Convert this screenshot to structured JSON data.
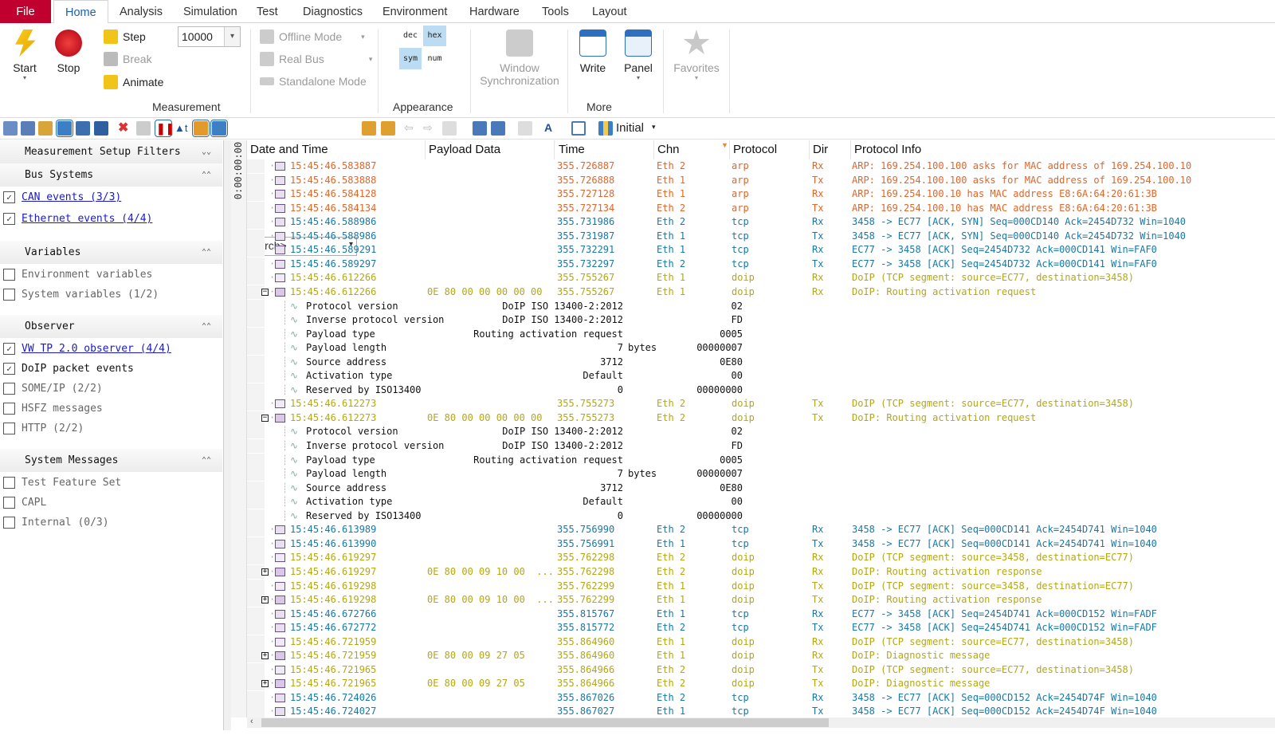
{
  "tabs": [
    "File",
    "Home",
    "Analysis",
    "Simulation",
    "Test",
    "Diagnostics",
    "Environment",
    "Hardware",
    "Tools",
    "Layout"
  ],
  "ribbon": {
    "start": "Start",
    "stop": "Stop",
    "step": "Step",
    "break": "Break",
    "animate": "Animate",
    "step_count": "10000",
    "offline_mode": "Offline Mode",
    "real_bus": "Real Bus",
    "standalone_mode": "Standalone Mode",
    "dec": "dec",
    "hex": "hex",
    "sym": "sym",
    "num": "num",
    "window_sync_1": "Window",
    "window_sync_2": "Synchronization",
    "write": "Write",
    "panel": "Panel",
    "favorites": "Favorites",
    "groups": {
      "measurement": "Measurement",
      "appearance": "Appearance",
      "more": "More"
    }
  },
  "toolbar": {
    "search_placeholder": "<Search>",
    "layout": "Initial"
  },
  "sidebar": {
    "title": "Measurement Setup Filters",
    "sections": [
      {
        "title": "Bus Systems",
        "items": [
          {
            "label": "CAN events (3/3)",
            "checked": true,
            "link": true
          },
          {
            "label": "Ethernet events (4/4)",
            "checked": true,
            "link": true
          }
        ]
      },
      {
        "title": "Variables",
        "items": [
          {
            "label": "Environment variables",
            "checked": false
          },
          {
            "label": "System variables (1/2)",
            "checked": false
          }
        ]
      },
      {
        "title": "Observer",
        "items": [
          {
            "label": "VW TP 2.0 observer (4/4)",
            "checked": true,
            "link": true
          },
          {
            "label": "DoIP packet events",
            "checked": true
          },
          {
            "label": "SOME/IP (2/2)",
            "checked": false
          },
          {
            "label": "HSFZ messages",
            "checked": false
          },
          {
            "label": "HTTP (2/2)",
            "checked": false
          }
        ]
      },
      {
        "title": "System Messages",
        "items": [
          {
            "label": "Test Feature Set",
            "checked": false
          },
          {
            "label": "CAPL",
            "checked": false
          },
          {
            "label": "Internal (0/3)",
            "checked": false
          }
        ]
      }
    ]
  },
  "time_offset": "0:00:00:00",
  "colors": {
    "arp": "#e0662a",
    "tcp": "#1a78a6",
    "doip": "#b3a814",
    "detail": "#111111"
  },
  "columns": [
    "Date and Time",
    "Payload Data",
    "Time",
    "Chn",
    "Protocol",
    "Dir",
    "Protocol Info"
  ],
  "rows": [
    {
      "k": "arp",
      "t": "15:45:46.583887",
      "p": "",
      "tm": "355.726887",
      "c": "Eth 2",
      "pr": "arp",
      "d": "Rx",
      "i": "ARP: 169.254.100.100 asks for MAC address of 169.254.100.10"
    },
    {
      "k": "arp",
      "t": "15:45:46.583888",
      "p": "",
      "tm": "355.726888",
      "c": "Eth 1",
      "pr": "arp",
      "d": "Tx",
      "i": "ARP: 169.254.100.100 asks for MAC address of 169.254.100.10"
    },
    {
      "k": "arp",
      "t": "15:45:46.584128",
      "p": "",
      "tm": "355.727128",
      "c": "Eth 1",
      "pr": "arp",
      "d": "Rx",
      "i": "ARP: 169.254.100.10 has MAC address E8:6A:64:20:61:3B"
    },
    {
      "k": "arp",
      "t": "15:45:46.584134",
      "p": "",
      "tm": "355.727134",
      "c": "Eth 2",
      "pr": "arp",
      "d": "Tx",
      "i": "ARP: 169.254.100.10 has MAC address E8:6A:64:20:61:3B"
    },
    {
      "k": "tcp",
      "t": "15:45:46.588986",
      "p": "",
      "tm": "355.731986",
      "c": "Eth 2",
      "pr": "tcp",
      "d": "Rx",
      "i": "3458 -> EC77 [ACK, SYN] Seq=000CD140 Ack=2454D732 Win=1040"
    },
    {
      "k": "tcp",
      "t": "15:45:46.588986",
      "p": "",
      "tm": "355.731987",
      "c": "Eth 1",
      "pr": "tcp",
      "d": "Tx",
      "i": "3458 -> EC77 [ACK, SYN] Seq=000CD140 Ack=2454D732 Win=1040"
    },
    {
      "k": "tcp",
      "t": "15:45:46.589291",
      "p": "",
      "tm": "355.732291",
      "c": "Eth 1",
      "pr": "tcp",
      "d": "Rx",
      "i": "EC77 -> 3458 [ACK] Seq=2454D732 Ack=000CD141 Win=FAF0"
    },
    {
      "k": "tcp",
      "t": "15:45:46.589297",
      "p": "",
      "tm": "355.732297",
      "c": "Eth 2",
      "pr": "tcp",
      "d": "Tx",
      "i": "EC77 -> 3458 [ACK] Seq=2454D732 Ack=000CD141 Win=FAF0"
    },
    {
      "k": "doip",
      "seg": true,
      "t": "15:45:46.612266",
      "p": "",
      "tm": "355.755267",
      "c": "Eth 1",
      "pr": "doip",
      "d": "Rx",
      "i": "DoIP (TCP segment: source=EC77, destination=3458)"
    },
    {
      "k": "doip",
      "exp": "-",
      "t": "15:45:46.612266",
      "p": "0E 80 00 00 00 00 00",
      "tm": "355.755267",
      "c": "Eth 1",
      "pr": "doip",
      "d": "Rx",
      "i": "DoIP: Routing activation request"
    },
    {
      "k": "det",
      "n": "Protocol version",
      "v": "DoIP ISO 13400-2:2012",
      "u": "",
      "r": "02"
    },
    {
      "k": "det",
      "n": "Inverse protocol version",
      "v": "DoIP ISO 13400-2:2012",
      "u": "",
      "r": "FD"
    },
    {
      "k": "det",
      "n": "Payload type",
      "v": "Routing activation request",
      "u": "",
      "r": "0005"
    },
    {
      "k": "det",
      "n": "Payload length",
      "v": "7",
      "u": "bytes",
      "r": "00000007"
    },
    {
      "k": "det",
      "n": "Source address",
      "v": "3712",
      "u": "",
      "r": "0E80"
    },
    {
      "k": "det",
      "n": "Activation type",
      "v": "Default",
      "u": "",
      "r": "00"
    },
    {
      "k": "det",
      "n": "Reserved by ISO13400",
      "v": "0",
      "u": "",
      "r": "00000000"
    },
    {
      "k": "doip",
      "seg": true,
      "t": "15:45:46.612273",
      "p": "",
      "tm": "355.755273",
      "c": "Eth 2",
      "pr": "doip",
      "d": "Tx",
      "i": "DoIP (TCP segment: source=EC77, destination=3458)"
    },
    {
      "k": "doip",
      "exp": "-",
      "t": "15:45:46.612273",
      "p": "0E 80 00 00 00 00 00",
      "tm": "355.755273",
      "c": "Eth 2",
      "pr": "doip",
      "d": "Tx",
      "i": "DoIP: Routing activation request"
    },
    {
      "k": "det",
      "n": "Protocol version",
      "v": "DoIP ISO 13400-2:2012",
      "u": "",
      "r": "02"
    },
    {
      "k": "det",
      "n": "Inverse protocol version",
      "v": "DoIP ISO 13400-2:2012",
      "u": "",
      "r": "FD"
    },
    {
      "k": "det",
      "n": "Payload type",
      "v": "Routing activation request",
      "u": "",
      "r": "0005"
    },
    {
      "k": "det",
      "n": "Payload length",
      "v": "7",
      "u": "bytes",
      "r": "00000007"
    },
    {
      "k": "det",
      "n": "Source address",
      "v": "3712",
      "u": "",
      "r": "0E80"
    },
    {
      "k": "det",
      "n": "Activation type",
      "v": "Default",
      "u": "",
      "r": "00"
    },
    {
      "k": "det",
      "n": "Reserved by ISO13400",
      "v": "0",
      "u": "",
      "r": "00000000"
    },
    {
      "k": "tcp",
      "t": "15:45:46.613989",
      "p": "",
      "tm": "355.756990",
      "c": "Eth 2",
      "pr": "tcp",
      "d": "Rx",
      "i": "3458 -> EC77 [ACK] Seq=000CD141 Ack=2454D741 Win=1040"
    },
    {
      "k": "tcp",
      "t": "15:45:46.613990",
      "p": "",
      "tm": "355.756991",
      "c": "Eth 1",
      "pr": "tcp",
      "d": "Tx",
      "i": "3458 -> EC77 [ACK] Seq=000CD141 Ack=2454D741 Win=1040"
    },
    {
      "k": "doip",
      "seg": true,
      "t": "15:45:46.619297",
      "p": "",
      "tm": "355.762298",
      "c": "Eth 2",
      "pr": "doip",
      "d": "Rx",
      "i": "DoIP (TCP segment: source=3458, destination=EC77)"
    },
    {
      "k": "doip",
      "exp": "+",
      "t": "15:45:46.619297",
      "p": "0E 80 00 09 10 00  ...",
      "tm": "355.762298",
      "c": "Eth 2",
      "pr": "doip",
      "d": "Rx",
      "i": "DoIP: Routing activation response"
    },
    {
      "k": "doip",
      "seg": true,
      "t": "15:45:46.619298",
      "p": "",
      "tm": "355.762299",
      "c": "Eth 1",
      "pr": "doip",
      "d": "Tx",
      "i": "DoIP (TCP segment: source=3458, destination=EC77)"
    },
    {
      "k": "doip",
      "exp": "+",
      "t": "15:45:46.619298",
      "p": "0E 80 00 09 10 00  ...",
      "tm": "355.762299",
      "c": "Eth 1",
      "pr": "doip",
      "d": "Tx",
      "i": "DoIP: Routing activation response"
    },
    {
      "k": "tcp",
      "t": "15:45:46.672766",
      "p": "",
      "tm": "355.815767",
      "c": "Eth 1",
      "pr": "tcp",
      "d": "Rx",
      "i": "EC77 -> 3458 [ACK] Seq=2454D741 Ack=000CD152 Win=FADF"
    },
    {
      "k": "tcp",
      "t": "15:45:46.672772",
      "p": "",
      "tm": "355.815772",
      "c": "Eth 2",
      "pr": "tcp",
      "d": "Tx",
      "i": "EC77 -> 3458 [ACK] Seq=2454D741 Ack=000CD152 Win=FADF"
    },
    {
      "k": "doip",
      "seg": true,
      "t": "15:45:46.721959",
      "p": "",
      "tm": "355.864960",
      "c": "Eth 1",
      "pr": "doip",
      "d": "Rx",
      "i": "DoIP (TCP segment: source=EC77, destination=3458)"
    },
    {
      "k": "doip",
      "exp": "+",
      "t": "15:45:46.721959",
      "p": "0E 80 00 09 27 05",
      "tm": "355.864960",
      "c": "Eth 1",
      "pr": "doip",
      "d": "Rx",
      "i": "DoIP: Diagnostic message"
    },
    {
      "k": "doip",
      "seg": true,
      "t": "15:45:46.721965",
      "p": "",
      "tm": "355.864966",
      "c": "Eth 2",
      "pr": "doip",
      "d": "Tx",
      "i": "DoIP (TCP segment: source=EC77, destination=3458)"
    },
    {
      "k": "doip",
      "exp": "+",
      "t": "15:45:46.721965",
      "p": "0E 80 00 09 27 05",
      "tm": "355.864966",
      "c": "Eth 2",
      "pr": "doip",
      "d": "Tx",
      "i": "DoIP: Diagnostic message"
    },
    {
      "k": "tcp",
      "t": "15:45:46.724026",
      "p": "",
      "tm": "355.867026",
      "c": "Eth 2",
      "pr": "tcp",
      "d": "Rx",
      "i": "3458 -> EC77 [ACK] Seq=000CD152 Ack=2454D74F Win=1040"
    },
    {
      "k": "tcp",
      "t": "15:45:46.724027",
      "p": "",
      "tm": "355.867027",
      "c": "Eth 1",
      "pr": "tcp",
      "d": "Tx",
      "i": "3458 -> EC77 [ACK] Seq=000CD152 Ack=2454D74F Win=1040"
    }
  ]
}
